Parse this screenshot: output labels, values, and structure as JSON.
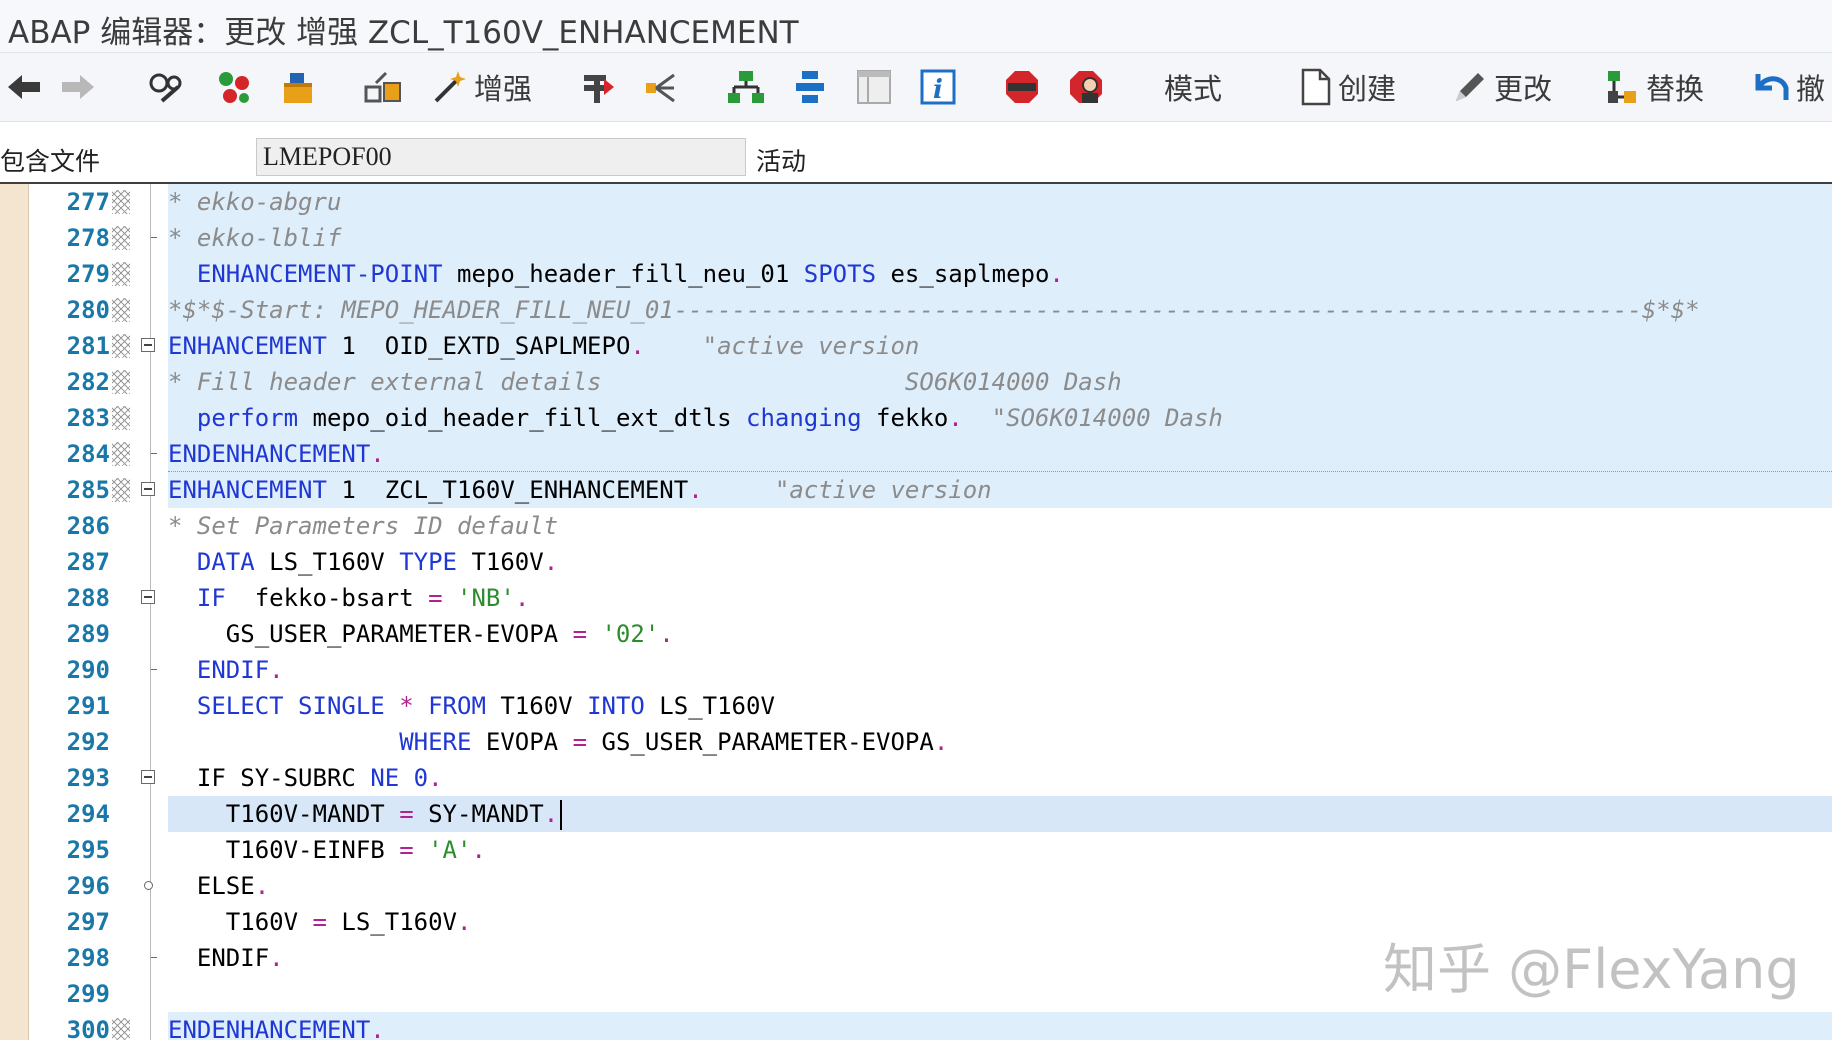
{
  "window": {
    "title": "ABAP 编辑器：更改 增强 ZCL_T160V_ENHANCEMENT"
  },
  "toolbar": {
    "enhance_label": "增强",
    "mode_label": "模式",
    "create_label": "创建",
    "change_label": "更改",
    "replace_label": "替换",
    "undo_label": "撤"
  },
  "include": {
    "label": "包含文件",
    "value": "LMEPOF00",
    "status": "活动"
  },
  "colors": {
    "keyword": "#1f37d3",
    "string": "#2d8c2d",
    "comment": "#8b8b8b",
    "line_number": "#1a78a8",
    "highlight": "#dfeefb"
  },
  "lines": [
    {
      "num": "277"
    },
    {
      "num": "278"
    },
    {
      "num": "279"
    },
    {
      "num": "280"
    },
    {
      "num": "281"
    },
    {
      "num": "282"
    },
    {
      "num": "283"
    },
    {
      "num": "284"
    },
    {
      "num": "285"
    },
    {
      "num": "286"
    },
    {
      "num": "287"
    },
    {
      "num": "288"
    },
    {
      "num": "289"
    },
    {
      "num": "290"
    },
    {
      "num": "291"
    },
    {
      "num": "292"
    },
    {
      "num": "293"
    },
    {
      "num": "294"
    },
    {
      "num": "295"
    },
    {
      "num": "296"
    },
    {
      "num": "297"
    },
    {
      "num": "298"
    },
    {
      "num": "299"
    },
    {
      "num": "300"
    }
  ],
  "code": {
    "l277": "* ekko-abgru",
    "l278": "* ekko-lblif",
    "l279": {
      "kw1": "ENHANCEMENT-POINT",
      "t1": " mepo_header_fill_neu_01 ",
      "kw2": "SPOTS",
      "t2": " es_saplmepo",
      "p": "."
    },
    "l280": "*$*$-Start: MEPO_HEADER_FILL_NEU_01-------------------------------------------------------------------$*$*",
    "l281": {
      "kw": "ENHANCEMENT",
      "t": " 1  OID_EXTD_SAPLMEPO",
      "p": ".",
      "cm": "    \"active version"
    },
    "l282": {
      "cm1": "* Fill header external details",
      "cm2": "                     SO6K014000 Dash"
    },
    "l283": {
      "kw1": "perform",
      "t1": " mepo_oid_header_fill_ext_dtls ",
      "kw2": "changing",
      "t2": " fekko",
      "p": ".",
      "cm": "  \"SO6K014000 Dash"
    },
    "l284": {
      "kw": "ENDENHANCEMENT",
      "p": "."
    },
    "l285": {
      "kw": "ENHANCEMENT",
      "t": " 1  ZCL_T160V_ENHANCEMENT",
      "p": ".",
      "cm": "     \"active version"
    },
    "l286": "* Set Parameters ID default",
    "l287": {
      "kw1": "DATA",
      "t1": " LS_T160V ",
      "kw2": "TYPE",
      "t2": " T160V",
      "p": "."
    },
    "l288": {
      "kw": "IF",
      "t": "  fekko-bsart ",
      "op": "=",
      "s": " 'NB'",
      "p": "."
    },
    "l289": {
      "t": "GS_USER_PARAMETER-EVOPA ",
      "op": "=",
      "s": " '02'",
      "p": "."
    },
    "l290": {
      "kw": "ENDIF",
      "p": "."
    },
    "l291": {
      "kw1": "SELECT SINGLE",
      "op": " * ",
      "kw2": "FROM",
      "t1": " T160V ",
      "kw3": "INTO",
      "t2": " LS_T160V"
    },
    "l292": {
      "kw": "WHERE",
      "t1": " EVOPA ",
      "op": "=",
      "t2": " GS_USER_PARAMETER-EVOPA",
      "p": "."
    },
    "l293": {
      "kw1": "IF",
      "t1": " SY-SUBRC ",
      "kw2": "NE",
      "n": " 0",
      "p": "."
    },
    "l294": {
      "t1": "T160V-MANDT ",
      "op": "=",
      "t2": " SY-MANDT",
      "p": "."
    },
    "l295": {
      "t1": "T160V-EINFB ",
      "op": "=",
      "s": " 'A'",
      "p": "."
    },
    "l296": {
      "kw": "ELSE",
      "p": "."
    },
    "l297": {
      "t1": "T160V ",
      "op": "=",
      "t2": " LS_T160V",
      "p": "."
    },
    "l298": {
      "kw": "ENDIF",
      "p": "."
    },
    "l300": {
      "kw": "ENDENHANCEMENT",
      "p": "."
    }
  },
  "watermark": "知乎 @FlexYang"
}
